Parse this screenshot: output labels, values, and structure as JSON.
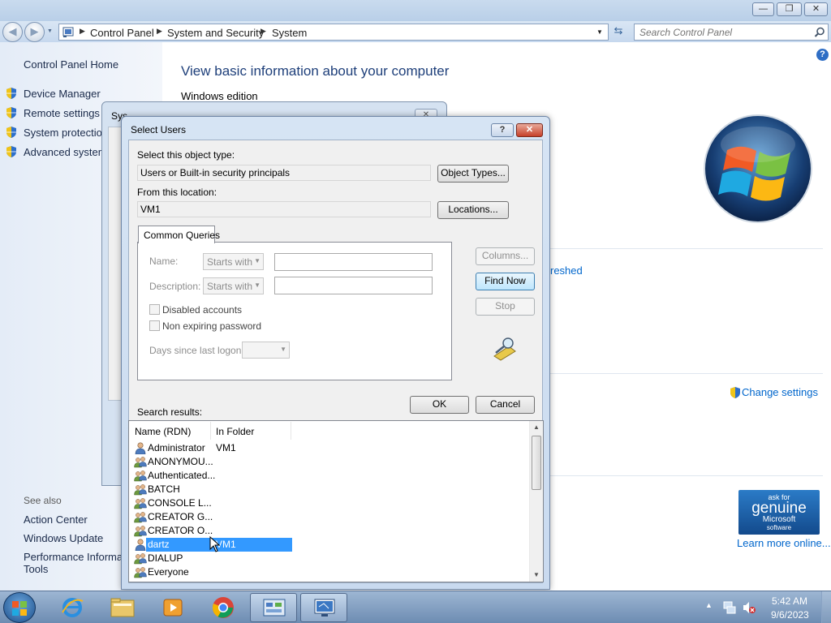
{
  "window": {
    "caption_buttons": {
      "minimize": "—",
      "maximize": "❐",
      "close": "✕"
    }
  },
  "address": {
    "crumbs": [
      "Control Panel",
      "System and Security",
      "System"
    ],
    "search_placeholder": "Search Control Panel"
  },
  "left_pane": {
    "home": "Control Panel Home",
    "tasks": [
      "Device Manager",
      "Remote settings",
      "System protection",
      "Advanced system"
    ],
    "see_also_title": "See also",
    "see_also": [
      "Action Center",
      "Windows Update",
      "Performance Informati",
      "Tools"
    ]
  },
  "main": {
    "heading": "View basic information about your computer",
    "section": "Windows edition",
    "refreshed_link": "reshed",
    "change_settings": "Change settings",
    "genuine": {
      "line1": "ask for",
      "line2": "genuine",
      "line3": "Microsoft",
      "line4": "software"
    },
    "learn_more": "Learn more online..."
  },
  "sysprops": {
    "title": "System Properties"
  },
  "dialog": {
    "title": "Select Users",
    "object_type_label": "Select this object type:",
    "object_type_value": "Users or Built-in security principals",
    "object_types_button": "Object Types...",
    "location_label": "From this location:",
    "location_value": "VM1",
    "locations_button": "Locations...",
    "tab": "Common Queries",
    "name_label": "Name:",
    "description_label": "Description:",
    "starts_with": "Starts with",
    "disabled_accounts": "Disabled accounts",
    "non_expiring": "Non expiring password",
    "days_since": "Days since last logon:",
    "columns_button": "Columns...",
    "find_now_button": "Find Now",
    "stop_button": "Stop",
    "ok_button": "OK",
    "cancel_button": "Cancel",
    "search_results_label": "Search results:",
    "help_button": "?",
    "close_button": "✕"
  },
  "results": {
    "columns": [
      "Name (RDN)",
      "In Folder"
    ],
    "rows": [
      {
        "name": "Administrator",
        "folder": "VM1",
        "type": "user"
      },
      {
        "name": "ANONYMOU...",
        "folder": "",
        "type": "group"
      },
      {
        "name": "Authenticated...",
        "folder": "",
        "type": "group"
      },
      {
        "name": "BATCH",
        "folder": "",
        "type": "group"
      },
      {
        "name": "CONSOLE L...",
        "folder": "",
        "type": "group"
      },
      {
        "name": "CREATOR G...",
        "folder": "",
        "type": "group"
      },
      {
        "name": "CREATOR O...",
        "folder": "",
        "type": "group"
      },
      {
        "name": "dartz",
        "folder": "VM1",
        "type": "user",
        "selected": true
      },
      {
        "name": "DIALUP",
        "folder": "",
        "type": "group"
      },
      {
        "name": "Everyone",
        "folder": "",
        "type": "group"
      }
    ]
  },
  "taskbar": {
    "time": "5:42 AM",
    "date": "9/6/2023"
  },
  "colors": {
    "accent": "#1e5799",
    "selection": "#3399ff",
    "link": "#0066cc"
  }
}
